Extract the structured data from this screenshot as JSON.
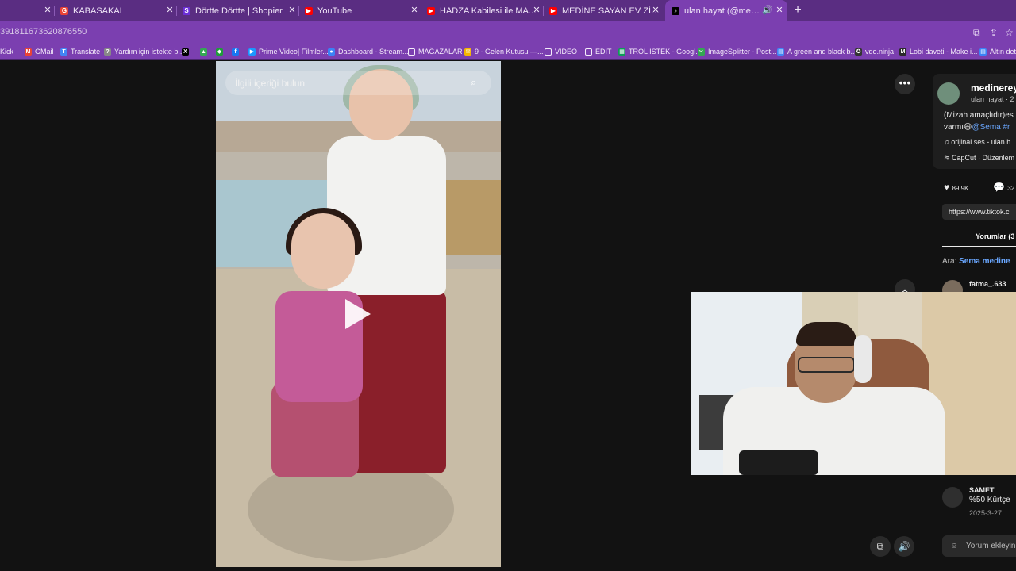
{
  "tabs": [
    {
      "title": "",
      "icon": "none-icon"
    },
    {
      "title": "KABASAKAL",
      "icon": "google-icon"
    },
    {
      "title": "Dörtte Dörtte | Shopier",
      "icon": "shopier-icon"
    },
    {
      "title": "YouTube",
      "icon": "youtube-icon"
    },
    {
      "title": "HADZA Kabilesi ile MAYMUN A",
      "icon": "youtube-icon"
    },
    {
      "title": "MEDİNE SAYAN EV ZİYARETİ - Y",
      "icon": "youtube-icon"
    },
    {
      "title": "ulan hayat (@medinereyis)",
      "icon": "tiktok-icon",
      "active": true
    }
  ],
  "address": {
    "url": "391811673620876550"
  },
  "bookmarks": [
    {
      "label": "Kick"
    },
    {
      "label": "GMail"
    },
    {
      "label": "Translate"
    },
    {
      "label": "Yardım için istekte b..."
    },
    {
      "label": ""
    },
    {
      "label": ""
    },
    {
      "label": ""
    },
    {
      "label": ""
    },
    {
      "label": "Prime Video| Filmler..."
    },
    {
      "label": "Dashboard - Stream..."
    },
    {
      "label": "MAĞAZALAR"
    },
    {
      "label": "9 - Gelen Kutusu —..."
    },
    {
      "label": "VIDEO"
    },
    {
      "label": "EDIT"
    },
    {
      "label": "TROL ISTEK - Googl..."
    },
    {
      "label": "ImageSplitter - Post..."
    },
    {
      "label": "A green and black b..."
    },
    {
      "label": "vdo.ninja"
    },
    {
      "label": "Lobi daveti - Make i..."
    },
    {
      "label": "Altın deta"
    }
  ],
  "player": {
    "search_placeholder": "İlgili içeriği bulun"
  },
  "panel": {
    "username": "medinerey",
    "subline": "ulan hayat · 2",
    "caption_line1": "(Mizah amaçlıdır)es",
    "caption_line2_prefix": "varmı😄",
    "caption_line2_mention": "@Sema #r",
    "music": "orijinal ses - ulan h",
    "capcut": "CapCut · Düzenlem",
    "likes": "89.9K",
    "comments": "32",
    "link": "https://www.tiktok.c",
    "comments_tab": "Yorumlar (3",
    "search_label": "Ara:",
    "search_term": "Sema medine",
    "comment1_user": "fatma_.633",
    "comment2_user": "SAMET",
    "comment2_text": "%50 Kürtçe",
    "comment2_date": "2025-3-27",
    "add_comment": "Yorum ekleyin..."
  },
  "colors": {
    "tabstrip": "#5a2d82",
    "toolbar": "#7b3fb0",
    "background": "#121212",
    "mention": "#6aa7ff"
  }
}
